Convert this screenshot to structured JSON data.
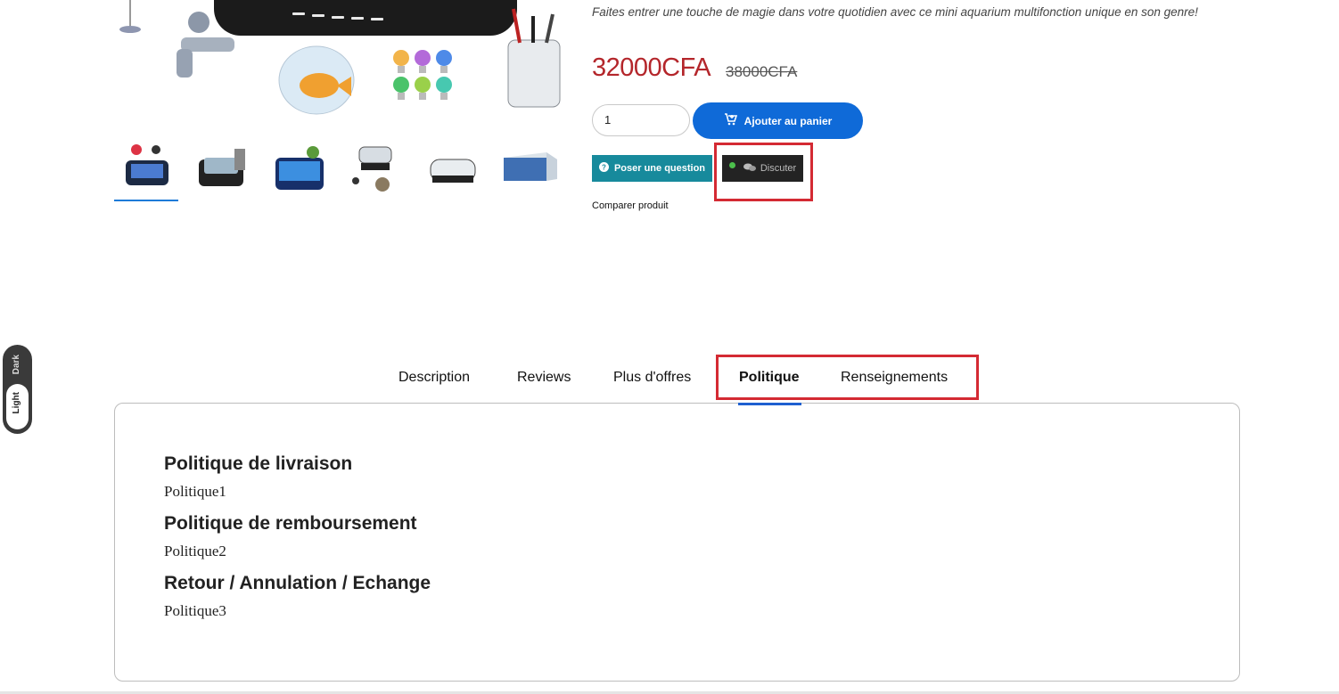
{
  "product": {
    "tagline": "Faites entrer une touche de magie dans votre quotidien avec ce mini aquarium multifonction unique en son genre!",
    "price": "32000CFA",
    "old_price": "38000CFA",
    "quantity": "1",
    "add_to_cart_label": "Ajouter au panier",
    "ask_question_label": "Poser une question",
    "chat_label": "Discuter",
    "compare_label": "Comparer produit",
    "thumbnails": [
      "aquarium-desk-set",
      "aquarium-pen-holder",
      "aquarium-lit-blue",
      "aquarium-accessories",
      "aquarium-clear-tank",
      "aquarium-box"
    ]
  },
  "theme_toggle": {
    "dark_label": "Dark",
    "light_label": "Light"
  },
  "tabs": [
    {
      "label": "Description"
    },
    {
      "label": "Reviews"
    },
    {
      "label": "Plus d'offres"
    },
    {
      "label": "Politique",
      "active": true
    },
    {
      "label": "Renseignements"
    }
  ],
  "policies": [
    {
      "title": "Politique de livraison",
      "text": "Politique1"
    },
    {
      "title": "Politique de remboursement",
      "text": "Politique2"
    },
    {
      "title": "Retour / Annulation / Echange",
      "text": "Politique3"
    }
  ],
  "colors": {
    "price": "#b4262b",
    "primary_button": "#0f6ad8",
    "ask_button": "#178a9c",
    "chat_button": "#232323",
    "highlight": "#d42a33"
  }
}
